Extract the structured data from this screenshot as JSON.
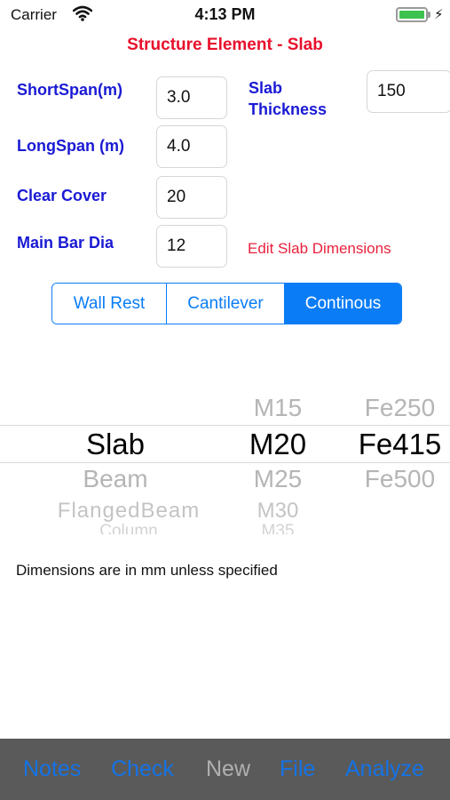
{
  "status": {
    "carrier": "Carrier",
    "time": "4:13 PM"
  },
  "page_title": "Structure Element - Slab",
  "form": {
    "short_span": {
      "label": "ShortSpan(m)",
      "value": "3.0"
    },
    "long_span": {
      "label": "LongSpan (m)",
      "value": "4.0"
    },
    "clear_cover": {
      "label": "Clear Cover",
      "value": "20"
    },
    "main_bar_dia": {
      "label": "Main Bar Dia",
      "value": "12"
    },
    "slab_thickness": {
      "label_line1": "Slab",
      "label_line2": "Thickness",
      "value": "150"
    }
  },
  "edit_link": "Edit Slab Dimensions",
  "segments": {
    "items": [
      "Wall Rest",
      "Cantilever",
      "Continous"
    ],
    "selected": "Continous"
  },
  "picker": {
    "element": {
      "selected": "Slab",
      "below": [
        "Beam",
        "FlangedBeam",
        "Column"
      ]
    },
    "concrete": {
      "above": [
        "M15"
      ],
      "selected": "M20",
      "below": [
        "M25",
        "M30",
        "M35"
      ]
    },
    "steel": {
      "above": [
        "Fe250"
      ],
      "selected": "Fe415",
      "below": [
        "Fe500"
      ]
    }
  },
  "note": "Dimensions are in mm unless specified",
  "tabbar": {
    "items": [
      "Notes",
      "Check",
      "New",
      "File",
      "Analyze"
    ],
    "disabled": "New"
  },
  "colors": {
    "accent": "#0a7cf5",
    "title_red": "#e8102c",
    "label_blue": "#1a1ad4",
    "tabbar_bg": "#5a5a5a",
    "battery_green": "#3ec24f"
  }
}
